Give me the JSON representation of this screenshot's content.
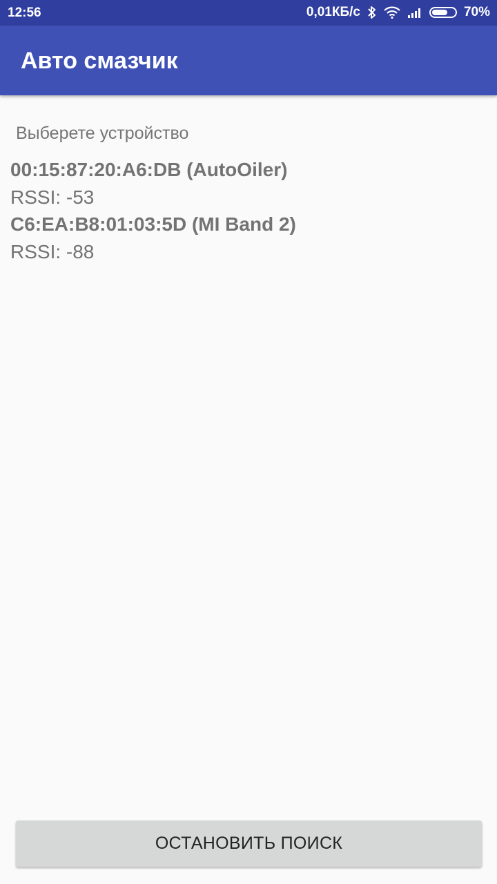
{
  "status_bar": {
    "time": "12:56",
    "network_speed": "0,01КБ/с",
    "battery_percent": "70%",
    "battery_level": 0.7,
    "icons": [
      "bluetooth-icon",
      "wifi-icon",
      "signal-icon",
      "battery-icon"
    ]
  },
  "app_bar": {
    "title": "Авто смазчик",
    "color": "#3f51b5"
  },
  "main": {
    "prompt": "Выберете устройство",
    "devices": [
      {
        "name": "00:15:87:20:A6:DB (AutoOiler)",
        "rssi": "RSSI: -53"
      },
      {
        "name": "C6:EA:B8:01:03:5D (MI Band 2)",
        "rssi": "RSSI: -88"
      }
    ]
  },
  "actions": {
    "stop_search_label": "ОСТАНОВИТЬ ПОИСК"
  }
}
